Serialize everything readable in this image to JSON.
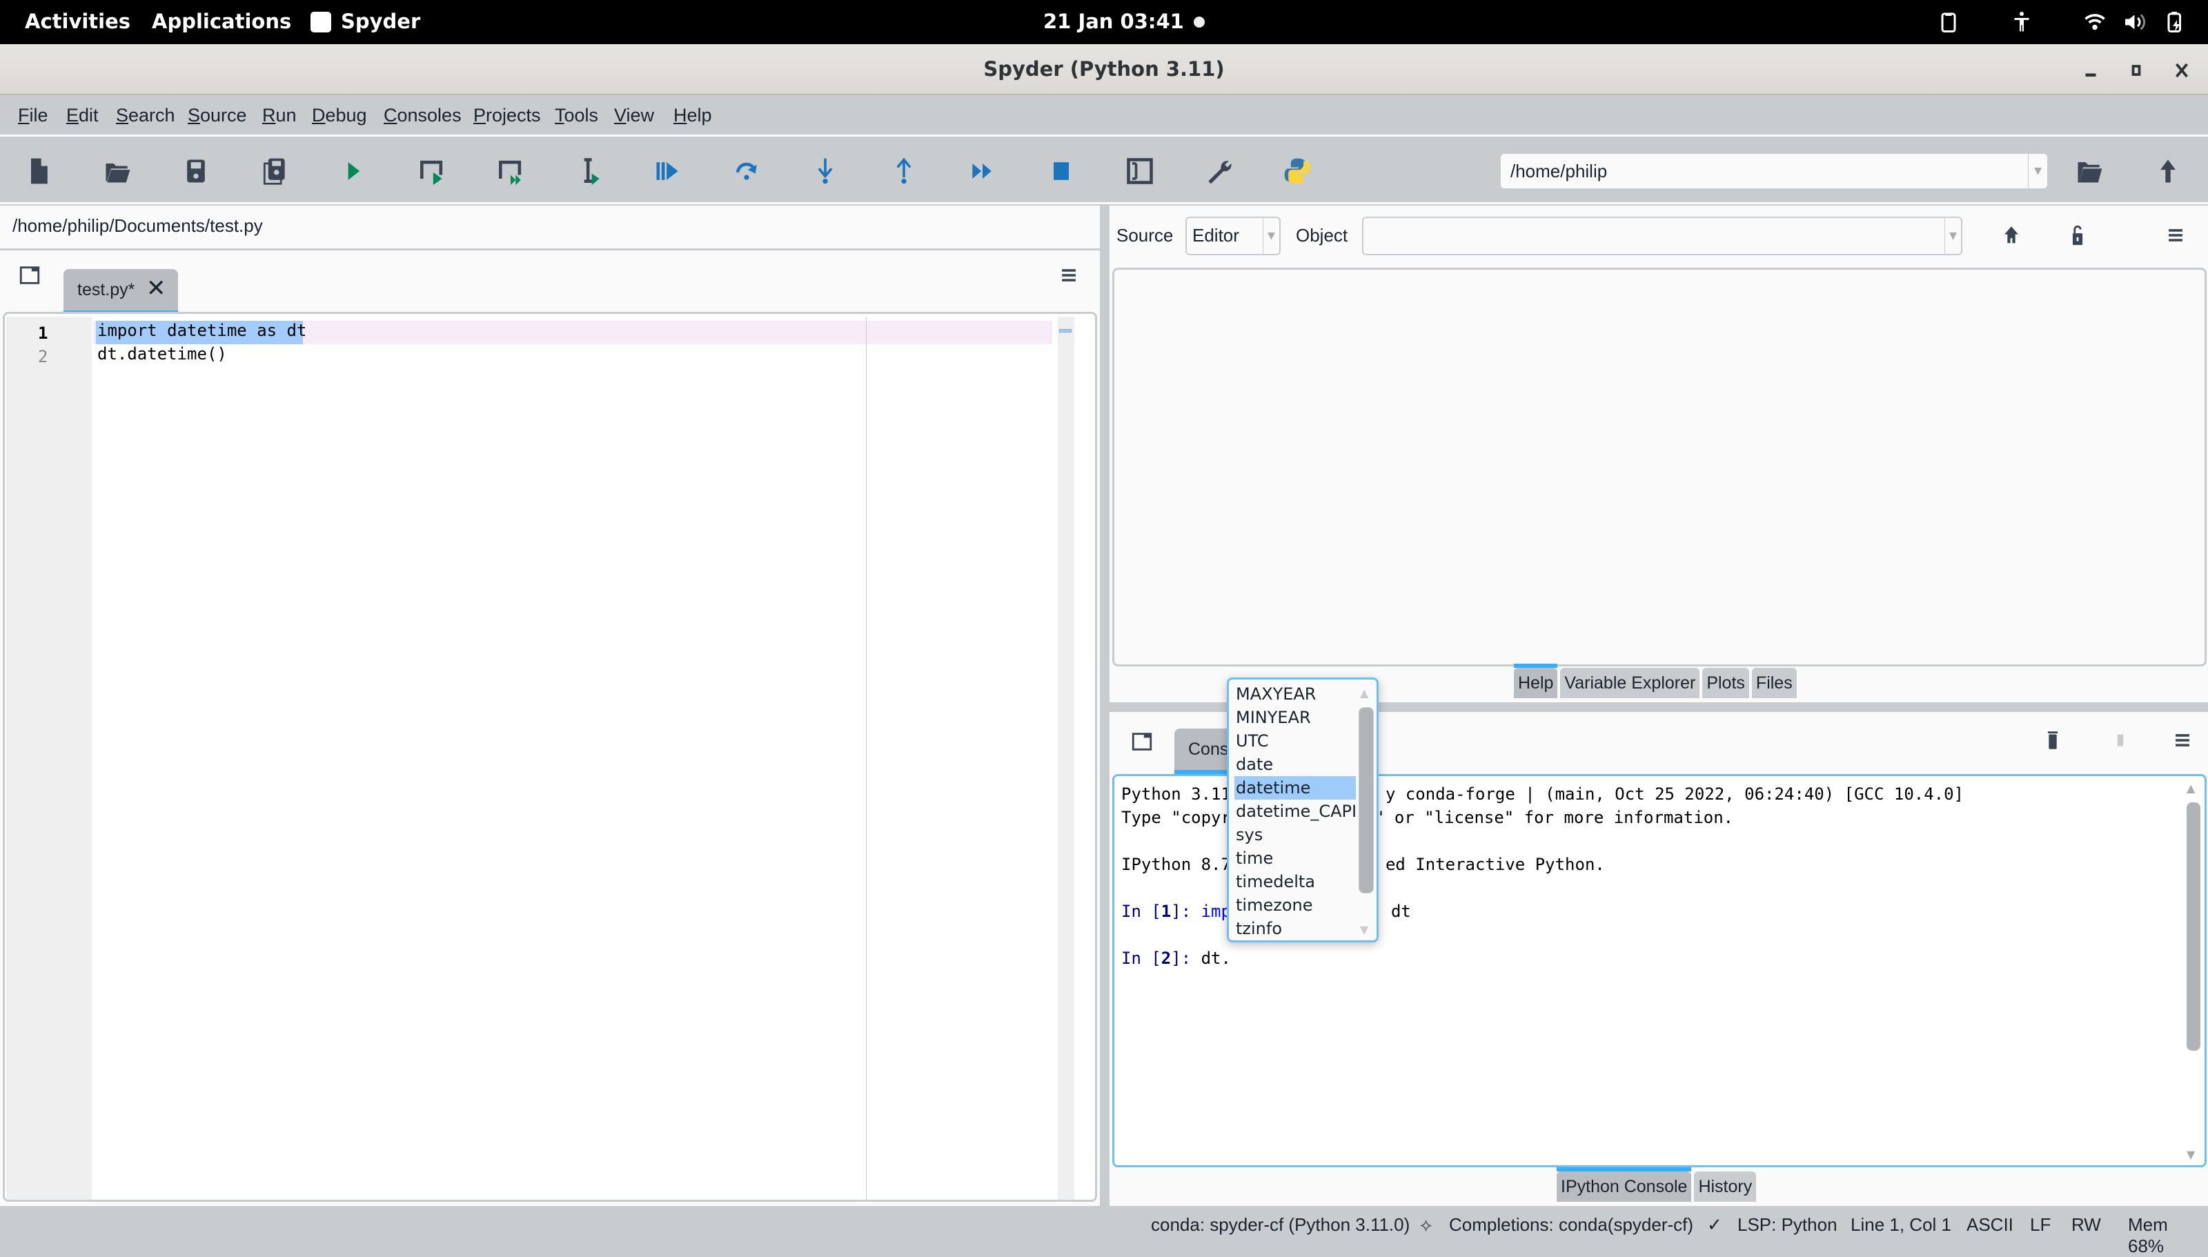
{
  "system_bar": {
    "activities": "Activities",
    "applications": "Applications",
    "app_name": "Spyder",
    "app_icon": "spyder-icon",
    "datetime": "21 Jan  03:41",
    "icons": [
      "clipboard-icon",
      "accessibility-icon",
      "wifi-icon",
      "volume-icon",
      "battery-charging-icon"
    ]
  },
  "window": {
    "title": "Spyder (Python 3.11)",
    "controls": [
      "minimize-icon",
      "maximize-icon",
      "close-icon"
    ]
  },
  "menubar": {
    "items": [
      "File",
      "Edit",
      "Search",
      "Source",
      "Run",
      "Debug",
      "Consoles",
      "Projects",
      "Tools",
      "View",
      "Help"
    ]
  },
  "toolbar": {
    "buttons": [
      "new-file",
      "open-file",
      "save-file",
      "save-all",
      "run",
      "run-cell",
      "run-cell-advance",
      "run-selection",
      "debug",
      "step-over",
      "step-into",
      "step-return",
      "continue",
      "stop-debug",
      "maximize-pane",
      "preferences",
      "python-path-manager"
    ],
    "cwd": "/home/philip",
    "browse_icon": "folder-open-icon",
    "parent_icon": "arrow-up-icon"
  },
  "editor": {
    "file_path": "/home/philip/Documents/test.py",
    "tab_label": "test.py*",
    "lines": [
      {
        "n": "1",
        "text": "import datetime as dt"
      },
      {
        "n": "2",
        "text": "dt.datetime()"
      }
    ],
    "current_line": 1
  },
  "help_pane": {
    "source_label": "Source",
    "source_value": "Editor",
    "object_label": "Object",
    "object_value": "",
    "tabs": [
      {
        "label": "Help",
        "active": true
      },
      {
        "label": "Variable Explorer",
        "active": false
      },
      {
        "label": "Plots",
        "active": false
      },
      {
        "label": "Files",
        "active": false
      }
    ]
  },
  "console_pane": {
    "tab_label": "Cons",
    "lines": {
      "l1a": "Python 3.11",
      "l1b": "y conda-forge | (main, Oct 25 2022, 06:24:40) [GCC 10.4.0]",
      "l2a": "Type \"copyr",
      "l2b": "\" or \"license\" for more information.",
      "l3a": "IPython 8.7",
      "l3b": "ed Interactive Python.",
      "in1_prompt": "In [",
      "in1_num": "1",
      "in1_close": "]: ",
      "in1_kw": "imp",
      "in1_rest": "dt",
      "in2_prompt": "In [",
      "in2_num": "2",
      "in2_close": "]: ",
      "in2_code": "dt."
    },
    "tabs": [
      {
        "label": "IPython Console",
        "active": true
      },
      {
        "label": "History",
        "active": false
      }
    ]
  },
  "completion": {
    "items": [
      "MAXYEAR",
      "MINYEAR",
      "UTC",
      "date",
      "datetime",
      "datetime_CAPI",
      "sys",
      "time",
      "timedelta",
      "timezone",
      "tzinfo"
    ],
    "selected": "datetime"
  },
  "statusbar": {
    "env": "conda: spyder-cf (Python 3.11.0)",
    "completions": "Completions: conda(spyder-cf)",
    "lsp": "LSP: Python",
    "position": "Line 1, Col 1",
    "encoding": "ASCII",
    "eol": "LF",
    "mode": "RW",
    "memory": "Mem 68%"
  }
}
